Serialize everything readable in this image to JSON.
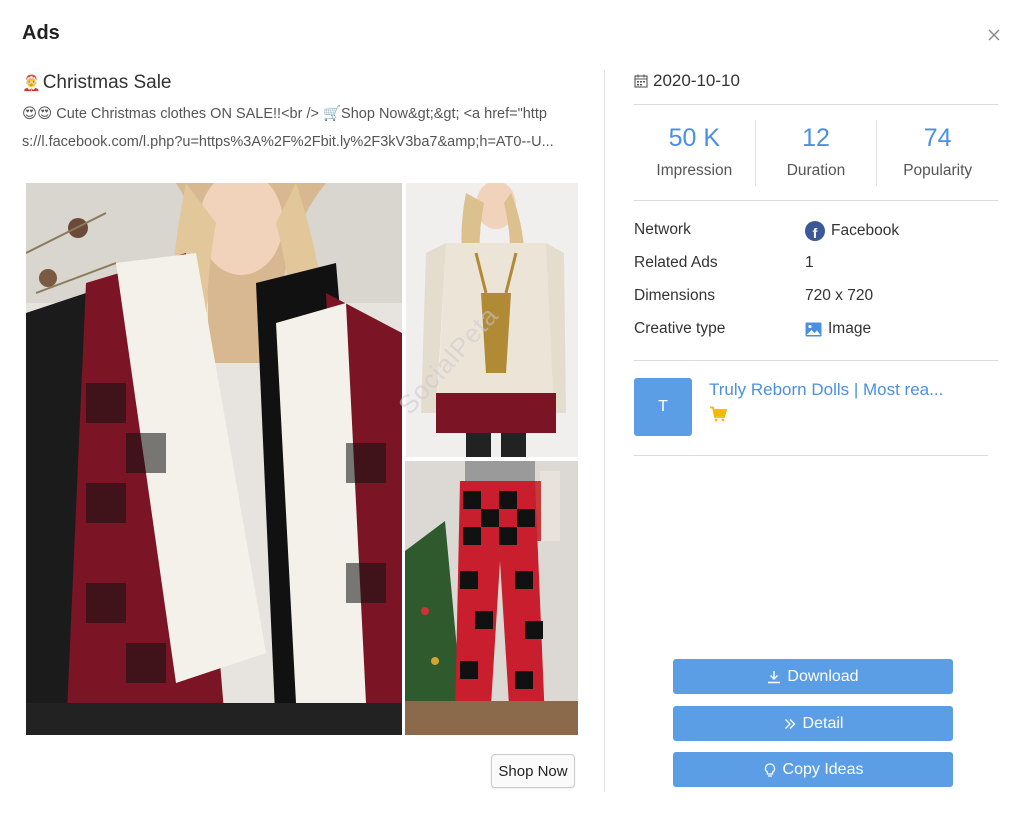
{
  "modal": {
    "title": "Ads",
    "close_icon": "close-icon"
  },
  "ad": {
    "title_emoji": "🤶",
    "title": "Christmas Sale",
    "text_line1": "😍😍 Cute Christmas clothes ON SALE!!<br /> 🛒Shop Now&gt;&gt; <a href=\"http",
    "text_line2": "s://l.facebook.com/l.php?u=https%3A%2F%2Fbit.ly%2F3kV3ba7&amp;h=AT0--U...",
    "watermark": "SocialPeta",
    "cta_label": "Shop Now"
  },
  "details": {
    "date": "2020-10-10",
    "date_icon": "calendar-icon",
    "stats": [
      {
        "value": "50 K",
        "label": "Impression"
      },
      {
        "value": "12",
        "label": "Duration"
      },
      {
        "value": "74",
        "label": "Popularity"
      }
    ],
    "info": [
      {
        "key": "Network",
        "value": "Facebook",
        "icon": "facebook-icon"
      },
      {
        "key": "Related Ads",
        "value": "1"
      },
      {
        "key": "Dimensions",
        "value": "720 x 720"
      },
      {
        "key": "Creative type",
        "value": "Image",
        "icon": "image-icon"
      }
    ],
    "advertiser": {
      "initial": "T",
      "name": "Truly Reborn Dolls | Most rea...",
      "icon": "shopping-cart-icon"
    }
  },
  "actions": {
    "download": "Download",
    "detail": "Detail",
    "copy_ideas": "Copy Ideas"
  },
  "colors": {
    "accent": "#4a90e2",
    "button": "#5b9ee6",
    "facebook": "#3b5998",
    "cart": "#f5b800"
  }
}
